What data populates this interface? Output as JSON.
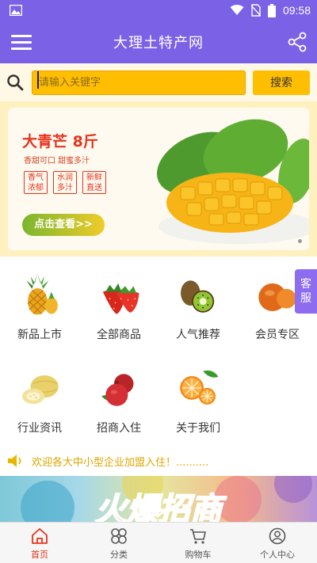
{
  "status_bar": {
    "time": "09:58",
    "icons": [
      "image-notification-icon",
      "wifi-icon",
      "no-sim-icon",
      "battery-icon"
    ]
  },
  "header": {
    "title": "大理土特产网",
    "menu_icon": "hamburger-menu-icon",
    "share_icon": "share-icon"
  },
  "search": {
    "placeholder": "请输入关键字",
    "button_label": "搜索",
    "icon": "search-icon"
  },
  "banner": {
    "title": "大青芒 8斤",
    "subtitle": "香甜可口  甜蜜多汁",
    "tags": [
      {
        "line1": "香气",
        "line2": "浓郁"
      },
      {
        "line1": "水润",
        "line2": "多汁"
      },
      {
        "line1": "新鲜",
        "line2": "直送"
      }
    ],
    "button_label": "点击查看>>"
  },
  "categories": [
    {
      "label": "新品上市",
      "icon": "pineapple-icon"
    },
    {
      "label": "全部商品",
      "icon": "strawberry-icon"
    },
    {
      "label": "人气推荐",
      "icon": "kiwi-icon"
    },
    {
      "label": "会员专区",
      "icon": "orange-fruit-icon"
    },
    {
      "label": "行业资讯",
      "icon": "melon-icon"
    },
    {
      "label": "招商入住",
      "icon": "pomegranate-icon"
    },
    {
      "label": "关于我们",
      "icon": "orange-slice-icon"
    }
  ],
  "service_tab": {
    "line1": "客",
    "line2": "服"
  },
  "notice": {
    "icon": "speaker-icon",
    "text": "欢迎各大中小型企业加盟入住！.........."
  },
  "promo": {
    "text": "火爆招商"
  },
  "tab_bar": {
    "tabs": [
      {
        "label": "首页",
        "icon": "home-icon",
        "active": true
      },
      {
        "label": "分类",
        "icon": "category-icon",
        "active": false
      },
      {
        "label": "购物车",
        "icon": "cart-icon",
        "active": false
      },
      {
        "label": "个人中心",
        "icon": "user-icon",
        "active": false
      }
    ]
  },
  "colors": {
    "primary": "#7b61e6",
    "accent": "#ffbe00",
    "active_tab": "#e8331c",
    "notice_text": "#e0a400"
  }
}
